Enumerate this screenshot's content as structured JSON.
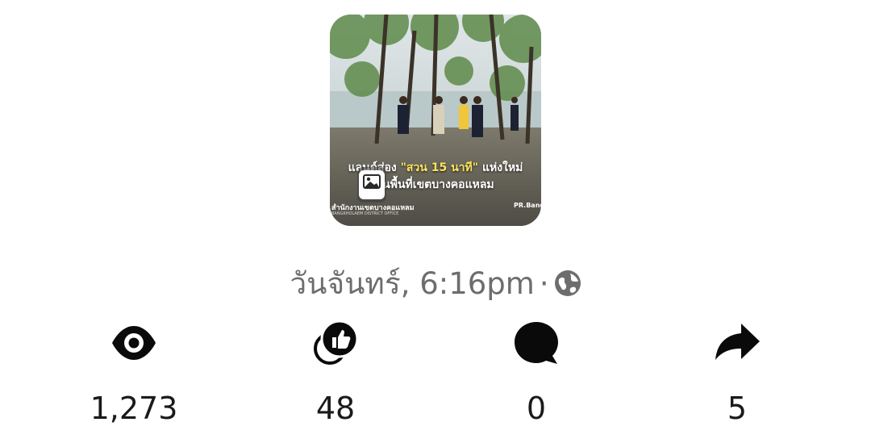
{
  "post": {
    "thumbnail": {
      "caption_prefix": "แลนด์ส่อง",
      "caption_highlight": "\"สวน 15 นาที\"",
      "caption_suffix": "แห่งใหม่",
      "caption_line2": "ในพื้นที่เขตบางคอแหลม",
      "watermark_left": "สำนักงานเขตบางคอแหลม",
      "watermark_left_sub": "BANGKHOLAEM DISTRICT OFFICE",
      "watermark_right": "PR.Bangk",
      "badge_icon": "photo-gallery-icon"
    },
    "timestamp": "วันจันทร์, 6:16pm",
    "separator": "·",
    "privacy_icon": "globe-icon"
  },
  "stats": {
    "views": {
      "icon": "eye-icon",
      "value": "1,273"
    },
    "reactions": {
      "icon": "like-reaction-icon",
      "value": "48"
    },
    "comments": {
      "icon": "comment-bubble-icon",
      "value": "0"
    },
    "shares": {
      "icon": "share-arrow-icon",
      "value": "5"
    }
  },
  "colors": {
    "timestamp": "#6d6d6d",
    "icons": "#0a0a0a",
    "values": "#1a1a1a"
  }
}
